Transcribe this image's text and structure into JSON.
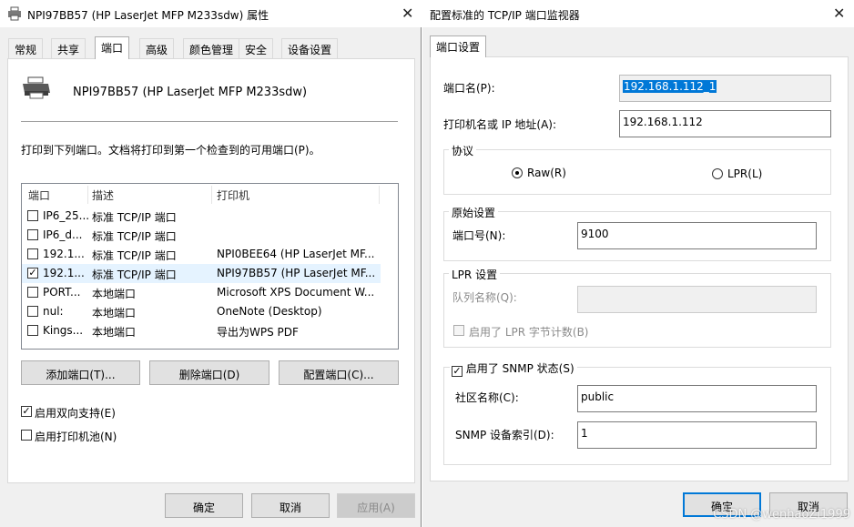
{
  "left_window": {
    "title": "NPI97BB57 (HP LaserJet MFP M233sdw) 属性",
    "tabs": [
      "常规",
      "共享",
      "端口",
      "高级",
      "颜色管理",
      "安全",
      "设备设置"
    ],
    "printer_name": "NPI97BB57 (HP LaserJet MFP M233sdw)",
    "instruction": "打印到下列端口。文档将打印到第一个检查到的可用端口(P)。",
    "columns": [
      "端口",
      "描述",
      "打印机"
    ],
    "rows": [
      {
        "port": "IP6_25...",
        "desc": "标准 TCP/IP 端口",
        "printer": "",
        "checked": false
      },
      {
        "port": "IP6_d...",
        "desc": "标准 TCP/IP 端口",
        "printer": "",
        "checked": false
      },
      {
        "port": "192.1...",
        "desc": "标准 TCP/IP 端口",
        "printer": "NPI0BEE64 (HP LaserJet MF...",
        "checked": false
      },
      {
        "port": "192.1...",
        "desc": "标准 TCP/IP 端口",
        "printer": "NPI97BB57 (HP LaserJet MF...",
        "checked": true
      },
      {
        "port": "PORT...",
        "desc": "本地端口",
        "printer": "Microsoft XPS Document W...",
        "checked": false
      },
      {
        "port": "nul:",
        "desc": "本地端口",
        "printer": "OneNote (Desktop)",
        "checked": false
      },
      {
        "port": "Kings...",
        "desc": "本地端口",
        "printer": "导出为WPS PDF",
        "checked": false
      }
    ],
    "add_port": "添加端口(T)...",
    "delete_port": "删除端口(D)",
    "configure_port": "配置端口(C)...",
    "bidi_support": "启用双向支持(E)",
    "bidi_checked": true,
    "printer_pool": "启用打印机池(N)",
    "pool_checked": false,
    "ok": "确定",
    "cancel": "取消",
    "apply": "应用(A)"
  },
  "right_window": {
    "title": "配置标准的 TCP/IP 端口监视器",
    "tab": "端口设置",
    "port_name_label": "端口名(P):",
    "port_name_value": "192.168.1.112_1",
    "host_label": "打印机名或 IP 地址(A):",
    "host_value": "192.168.1.112",
    "protocol_title": "协议",
    "raw_label": "Raw(R)",
    "lpr_label": "LPR(L)",
    "protocol_selected": "Raw",
    "raw_settings_title": "原始设置",
    "port_number_label": "端口号(N):",
    "port_number_value": "9100",
    "lpr_settings_title": "LPR 设置",
    "queue_name_label": "队列名称(Q):",
    "queue_name_value": "",
    "lpr_byte_count_label": "启用了 LPR 字节计数(B)",
    "snmp_label": "启用了 SNMP 状态(S)",
    "snmp_checked": true,
    "community_label": "社区名称(C):",
    "community_value": "public",
    "snmp_index_label": "SNMP 设备索引(D):",
    "snmp_index_value": "1",
    "ok": "确定",
    "cancel": "取消"
  },
  "watermark": "CSDN @wenhaoZi1999",
  "icons": {
    "printer": "printer-icon",
    "close": "close-icon",
    "scroll_up": "chevron-up-icon",
    "scroll_down": "chevron-down-icon"
  }
}
